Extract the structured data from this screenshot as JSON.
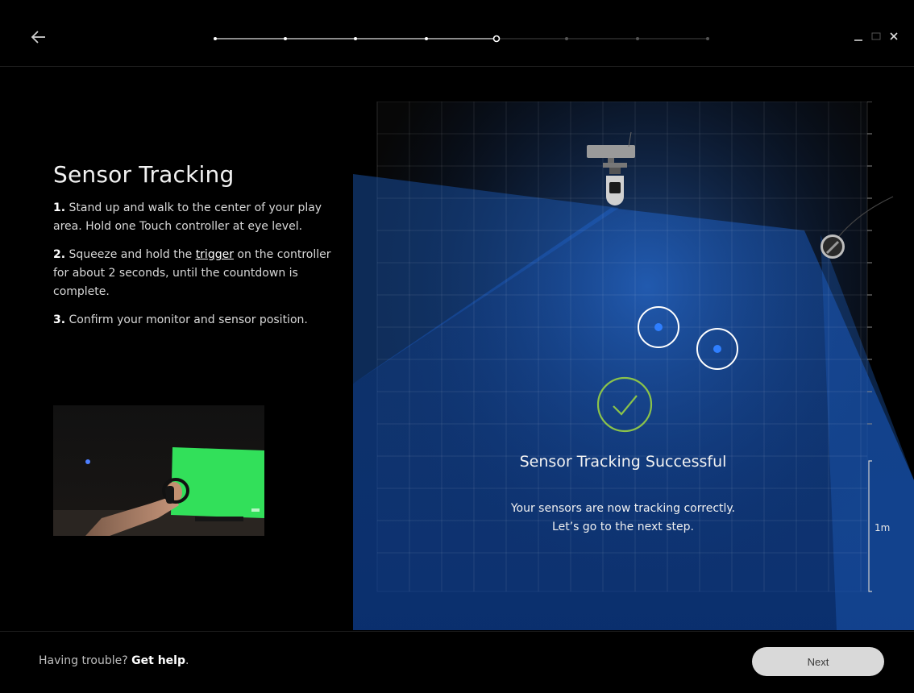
{
  "header": {
    "back_icon": "arrow-left-icon",
    "progress": {
      "total_steps": 8,
      "current_step": 5
    },
    "window_controls": [
      "minimize-icon",
      "maximize-icon",
      "close-icon"
    ]
  },
  "content": {
    "title": "Sensor Tracking",
    "steps": [
      {
        "num": "1.",
        "text": "Stand up and walk to the center of your play area. Hold one Touch controller at eye level."
      },
      {
        "num": "2.",
        "text_before": "Squeeze and hold the",
        "link": "trigger",
        "text_after": "on the controller for about 2 seconds, until the countdown is complete."
      },
      {
        "num": "3.",
        "text": "Confirm your monitor and sensor position."
      }
    ]
  },
  "visualization": {
    "status_title": "Sensor Tracking Successful",
    "message_line1": "Your sensors are now tracking correctly.",
    "message_line2": "Let’s go to the next step.",
    "scale_label": "1m",
    "colors": {
      "beam": "#1f6ad8",
      "check": "#8bc34a",
      "dot": "#2f7fff"
    }
  },
  "footer": {
    "help_prefix": "Having trouble?",
    "help_link": "Get help",
    "help_suffix": ".",
    "next_label": "Next"
  }
}
